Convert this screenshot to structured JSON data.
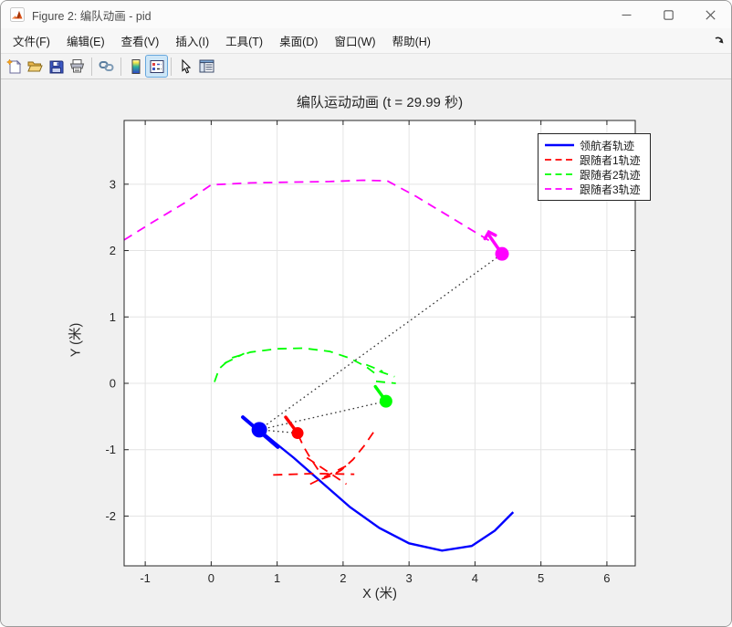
{
  "window": {
    "title": "Figure 2: 编队动画 - pid",
    "controls": [
      {
        "name": "minimize"
      },
      {
        "name": "maximize"
      },
      {
        "name": "close"
      }
    ]
  },
  "menu_bar": {
    "items": [
      {
        "label": "文件(F)"
      },
      {
        "label": "编辑(E)"
      },
      {
        "label": "查看(V)"
      },
      {
        "label": "插入(I)"
      },
      {
        "label": "工具(T)"
      },
      {
        "label": "桌面(D)"
      },
      {
        "label": "窗口(W)"
      },
      {
        "label": "帮助(H)"
      }
    ],
    "dock_icon": "dock-figure-arrow-icon"
  },
  "toolbar": {
    "buttons": [
      {
        "icon": "new-figure-icon",
        "active": false
      },
      {
        "icon": "open-file-icon",
        "active": false
      },
      {
        "icon": "save-figure-icon",
        "active": false
      },
      {
        "icon": "print-figure-icon",
        "active": false
      },
      {
        "icon": "link-plot-icon",
        "active": false
      },
      {
        "icon": "insert-colorbar-icon",
        "active": false
      },
      {
        "icon": "insert-legend-icon",
        "active": true
      },
      {
        "icon": "edit-plot-icon",
        "active": false
      },
      {
        "icon": "property-inspector-icon",
        "active": false
      }
    ]
  },
  "chart_data": {
    "type": "line",
    "title": "编队运动动画 (t = 29.99 秒)",
    "xlabel": "X (米)",
    "ylabel": "Y (米)",
    "xlim": [
      -1.32,
      6.43
    ],
    "ylim": [
      -2.75,
      3.96
    ],
    "xticks": [
      -1,
      0,
      1,
      2,
      3,
      4,
      5,
      6
    ],
    "yticks": [
      -2,
      -1,
      0,
      1,
      2,
      3
    ],
    "grid": true,
    "legend_position": "top-right",
    "colors": {
      "plot_bg": "#ffffff",
      "figure_bg": "#f0f0f0",
      "grid": "#e4e4e4",
      "axis": "#262626",
      "link_dotted": "#333333"
    },
    "series": [
      {
        "name": "领航者轨迹",
        "color": "#0000ff",
        "style": "solid",
        "width": 2.4,
        "segments": [
          [
            [
              0.73,
              -0.7
            ],
            [
              0.95,
              -0.88
            ],
            [
              1.25,
              -1.12
            ],
            [
              1.65,
              -1.47
            ],
            [
              2.1,
              -1.86
            ],
            [
              2.55,
              -2.18
            ],
            [
              3.0,
              -2.41
            ],
            [
              3.5,
              -2.52
            ],
            [
              3.95,
              -2.45
            ],
            [
              4.3,
              -2.22
            ],
            [
              4.58,
              -1.94
            ]
          ]
        ]
      },
      {
        "name": "跟随者1轨迹",
        "color": "#ff0000",
        "style": "dashed",
        "width": 1.8,
        "segments": [
          [
            [
              2.46,
              -0.74
            ],
            [
              2.32,
              -0.94
            ],
            [
              2.15,
              -1.15
            ],
            [
              1.97,
              -1.31
            ],
            [
              1.8,
              -1.4
            ],
            [
              1.65,
              -1.45
            ]
          ],
          [
            [
              0.94,
              -1.38
            ],
            [
              1.55,
              -1.36
            ],
            [
              2.17,
              -1.37
            ]
          ],
          [
            [
              1.45,
              -1.12
            ],
            [
              2.05,
              -1.52
            ]
          ],
          [
            [
              1.5,
              -1.52
            ],
            [
              2.1,
              -1.22
            ]
          ],
          [
            [
              1.62,
              -1.3
            ],
            [
              1.5,
              -1.12
            ],
            [
              1.4,
              -0.95
            ],
            [
              1.33,
              -0.8
            ]
          ]
        ]
      },
      {
        "name": "跟随者2轨迹",
        "color": "#00ff00",
        "style": "dashed",
        "width": 1.8,
        "segments": [
          [
            [
              0.05,
              0.02
            ],
            [
              0.12,
              0.22
            ],
            [
              0.3,
              0.38
            ],
            [
              0.6,
              0.47
            ],
            [
              1.0,
              0.52
            ],
            [
              1.4,
              0.53
            ],
            [
              1.8,
              0.48
            ],
            [
              2.1,
              0.38
            ],
            [
              2.35,
              0.25
            ],
            [
              2.55,
              0.1
            ]
          ],
          [
            [
              0.2,
              0.3
            ],
            [
              0.5,
              0.45
            ]
          ],
          [
            [
              2.35,
              0.28
            ],
            [
              2.6,
              0.18
            ]
          ],
          [
            [
              2.55,
              0.18
            ],
            [
              2.78,
              0.1
            ]
          ],
          [
            [
              2.5,
              0.03
            ],
            [
              2.8,
              0.0
            ]
          ]
        ]
      },
      {
        "name": "跟随者3轨迹",
        "color": "#ff00ff",
        "style": "dashed",
        "width": 1.8,
        "segments": [
          [
            [
              -1.32,
              2.16
            ],
            [
              -0.9,
              2.42
            ],
            [
              -0.4,
              2.72
            ],
            [
              0.0,
              2.99
            ],
            [
              0.6,
              3.02
            ],
            [
              1.2,
              3.03
            ],
            [
              1.8,
              3.04
            ],
            [
              2.3,
              3.06
            ],
            [
              2.67,
              3.05
            ],
            [
              3.1,
              2.82
            ],
            [
              3.6,
              2.52
            ],
            [
              4.05,
              2.25
            ],
            [
              4.3,
              2.1
            ]
          ]
        ]
      }
    ],
    "formation_links": {
      "style": "dotted",
      "color": "#333333",
      "from": [
        0.73,
        -0.7
      ],
      "to": [
        [
          1.31,
          -0.75
        ],
        [
          2.65,
          -0.27
        ],
        [
          4.41,
          1.95
        ]
      ]
    },
    "robots": [
      {
        "name": "leader",
        "color": "#0000ff",
        "pos": [
          0.73,
          -0.7
        ],
        "radius": 8.5,
        "heading": [
          [
            [
              0.48,
              -0.51
            ],
            [
              1.01,
              -0.96
            ]
          ]
        ],
        "heading_width": 4
      },
      {
        "name": "follower1",
        "color": "#ff0000",
        "pos": [
          1.31,
          -0.75
        ],
        "radius": 6.5,
        "heading": [
          [
            [
              1.13,
              -0.51
            ],
            [
              1.31,
              -0.75
            ]
          ]
        ],
        "heading_width": 3.5
      },
      {
        "name": "follower2",
        "color": "#00ff00",
        "pos": [
          2.65,
          -0.27
        ],
        "radius": 7,
        "heading": [
          [
            [
              2.49,
              -0.05
            ],
            [
              2.65,
              -0.27
            ]
          ]
        ],
        "heading_width": 3.5
      },
      {
        "name": "follower3",
        "color": "#ff00ff",
        "pos": [
          4.41,
          1.95
        ],
        "radius": 7.5,
        "heading": [
          [
            [
              4.22,
              2.22
            ],
            [
              4.41,
              1.95
            ]
          ],
          [
            [
              4.15,
              2.18
            ],
            [
              4.21,
              2.28
            ],
            [
              4.31,
              2.23
            ]
          ]
        ],
        "heading_width": 3.5
      }
    ]
  }
}
